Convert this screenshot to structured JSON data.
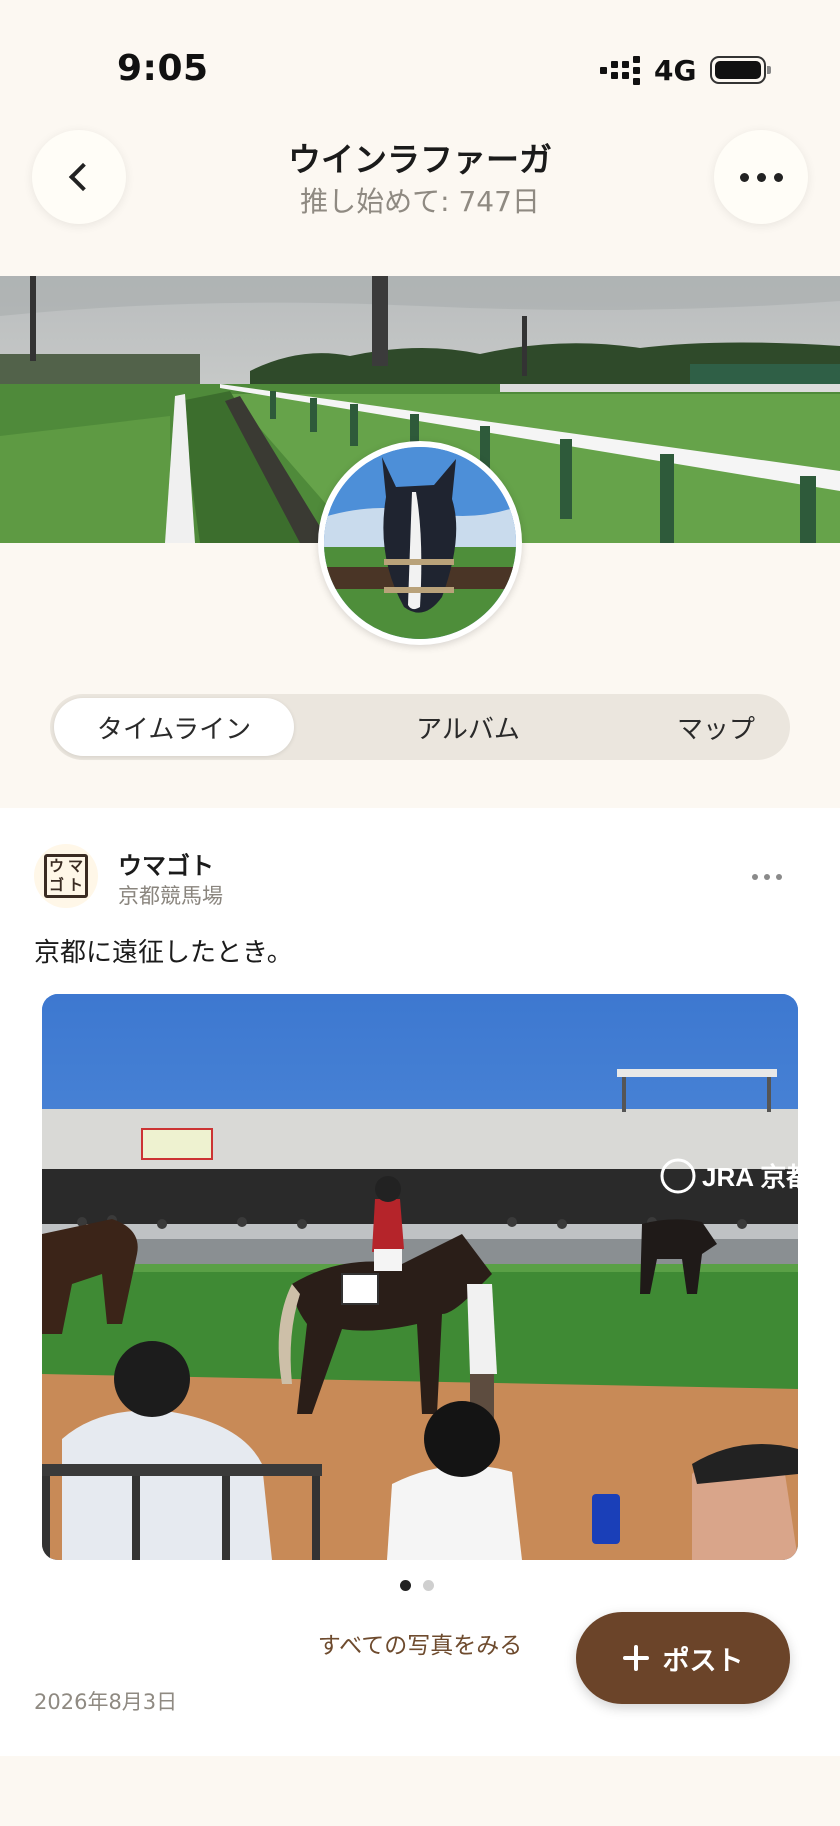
{
  "status_bar": {
    "time": "9:05",
    "network": "4G",
    "icons": [
      "signal-icon",
      "battery-icon"
    ]
  },
  "header": {
    "title": "ウインラファーガ",
    "subtitle": "推し始めて: 747日",
    "back_icon": "chevron-left-icon",
    "more_icon": "more-horizontal-icon"
  },
  "tabs": [
    {
      "label": "タイムライン",
      "active": true
    },
    {
      "label": "アルバム",
      "active": false
    },
    {
      "label": "マップ",
      "active": false
    }
  ],
  "post": {
    "author": "ウマゴト",
    "logo_chars": [
      "ウ",
      "マ",
      "ゴ",
      "ト"
    ],
    "place": "京都競馬場",
    "text": "京都に遠征したとき。",
    "photo_count": 2,
    "current_photo": 1,
    "see_all_label": "すべての写真をみる",
    "date": "2026年8月3日",
    "photo_signage": "JRA 京都"
  },
  "fab": {
    "label": "ポスト",
    "icon": "plus-icon",
    "color": "#6b4429"
  },
  "colors": {
    "background": "#fcf8f2",
    "card": "#ffffff",
    "accent_brown": "#6b4429"
  }
}
